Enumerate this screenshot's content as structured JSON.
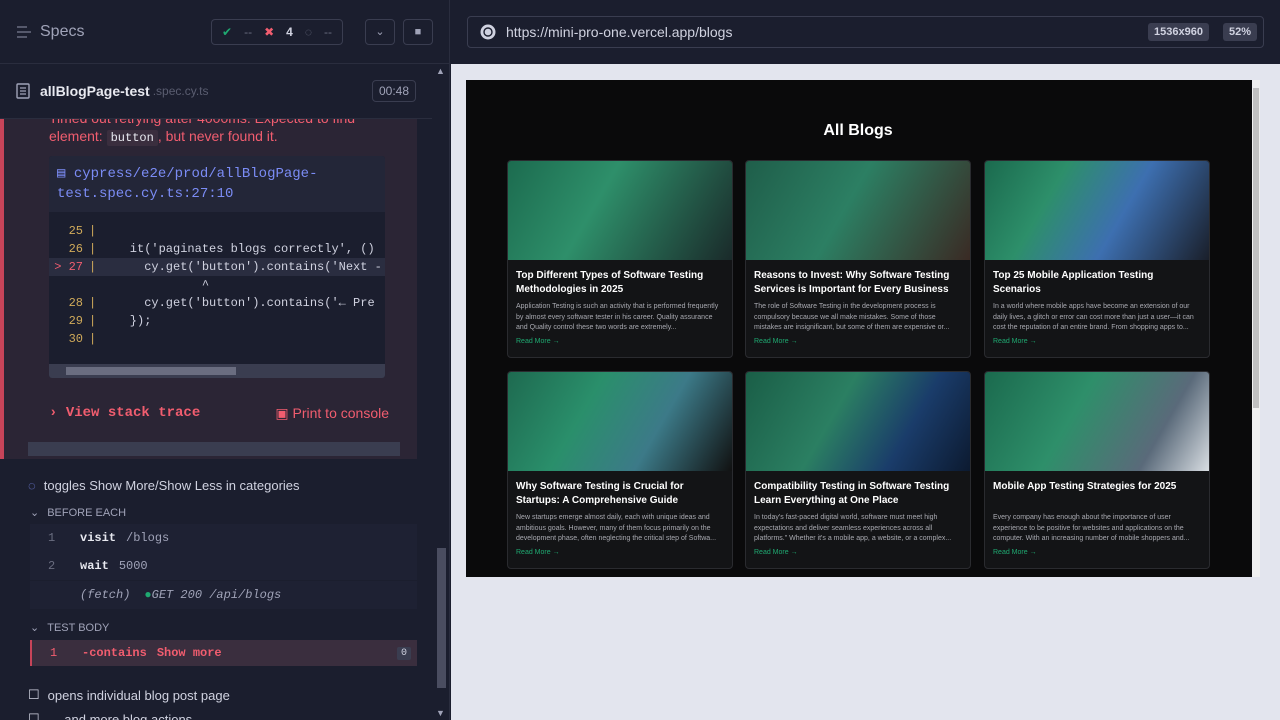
{
  "header": {
    "specs_label": "Specs",
    "stats": {
      "passed": "--",
      "failed": "4",
      "pending": "--"
    }
  },
  "spec": {
    "name": "allBlogPage-test",
    "ext": ".spec.cy.ts",
    "duration": "00:48"
  },
  "error": {
    "line1": "Timed out retrying after 4000ms: Expected to find",
    "element_label": "element:",
    "element_code": "button",
    "suffix": ", but never found it.",
    "file_path": "cypress/e2e/prod/allBlogPage-test.spec.cy.ts:27:10",
    "code_lines": [
      {
        "n": "25",
        "text": ""
      },
      {
        "n": "26",
        "text": "    it('paginates blogs correctly', () "
      },
      {
        "n": "> 27",
        "text": "      cy.get('button').contains('Next -"
      },
      {
        "n": "",
        "text": "              ^"
      },
      {
        "n": "28",
        "text": "      cy.get('button').contains('← Pre"
      },
      {
        "n": "29",
        "text": "    });"
      },
      {
        "n": "30",
        "text": ""
      }
    ],
    "view_stack": "View stack trace",
    "print_console": "Print to console"
  },
  "tests": {
    "running": "toggles Show More/Show Less in categories",
    "before_each_label": "BEFORE EACH",
    "before_cmds": [
      {
        "n": "1",
        "name": "visit",
        "arg": "/blogs"
      },
      {
        "n": "2",
        "name": "wait",
        "arg": "5000"
      }
    ],
    "fetch": {
      "label": "(fetch)",
      "detail": "GET 200 /api/blogs"
    },
    "test_body_label": "TEST BODY",
    "body_cmd": {
      "n": "1",
      "name": "-contains",
      "arg": "Show more",
      "badge": "0"
    },
    "next_test": "opens individual blog post page",
    "next_test2": "… and more blog actions"
  },
  "browser": {
    "url": "https://mini-pro-one.vercel.app/blogs",
    "viewport": "1536x960",
    "zoom": "52%"
  },
  "aut": {
    "title": "All Blogs",
    "cards": [
      {
        "title": "Top Different Types of Software Testing Methodologies in 2025",
        "desc": "Application Testing is such an activity that is performed frequently by almost every software tester in his career. Quality assurance and Quality control these two words are extremely...",
        "more": "Read More →"
      },
      {
        "title": "Reasons to Invest: Why Software Testing Services is Important for Every Business",
        "desc": "The role of Software Testing in the development process is compulsory because we all make mistakes. Some of those mistakes are insignificant, but some of them are expensive or...",
        "more": "Read More →"
      },
      {
        "title": "Top 25 Mobile Application Testing Scenarios",
        "desc": "In a world where mobile apps have become an extension of our daily lives, a glitch or error can cost more than just a user—it can cost the reputation of an entire brand. From shopping apps to...",
        "more": "Read More →"
      },
      {
        "title": "Why Software Testing is Crucial for Startups: A Comprehensive Guide",
        "desc": "New startups emerge almost daily, each with unique ideas and ambitious goals. However, many of them focus primarily on the development phase, often neglecting the critical step of Softwa...",
        "more": "Read More →"
      },
      {
        "title": "Compatibility Testing in Software Testing Learn Everything at One Place",
        "desc": "In today's fast-paced digital world, software must meet high expectations and deliver seamless experiences across all platforms.\" Whether it's a mobile app, a website, or a complex...",
        "more": "Read More →"
      },
      {
        "title": "Mobile App Testing Strategies for 2025",
        "desc": "Every company has enough about the importance of user experience to be positive for websites and applications on the computer. With an increasing number of mobile shoppers and...",
        "more": "Read More →"
      }
    ]
  }
}
